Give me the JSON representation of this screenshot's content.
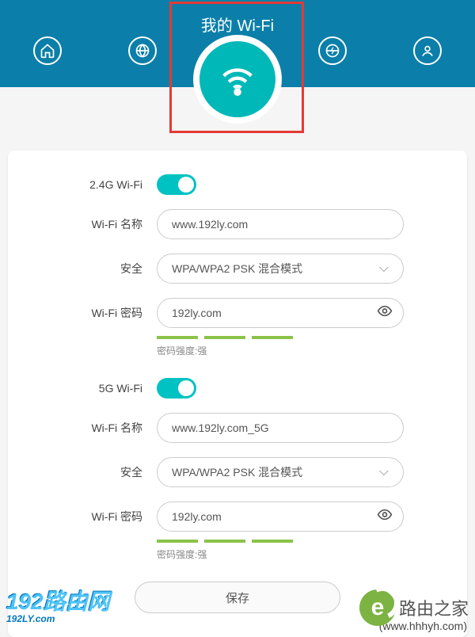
{
  "header": {
    "title": "我的 Wi-Fi",
    "nav": [
      "home",
      "globe",
      "wifi",
      "globe-bolt",
      "user"
    ]
  },
  "wifi24": {
    "band_label": "2.4G Wi-Fi",
    "enabled": true,
    "name_label": "Wi-Fi 名称",
    "name_value": "www.192ly.com",
    "security_label": "安全",
    "security_value": "WPA/WPA2 PSK 混合模式",
    "password_label": "Wi-Fi 密码",
    "password_value": "192ly.com",
    "strength_text": "密码强度:强"
  },
  "wifi5": {
    "band_label": "5G Wi-Fi",
    "enabled": true,
    "name_label": "Wi-Fi 名称",
    "name_value": "www.192ly.com_5G",
    "security_label": "安全",
    "security_value": "WPA/WPA2 PSK 混合模式",
    "password_label": "Wi-Fi 密码",
    "password_value": "192ly.com",
    "strength_text": "密码强度:强"
  },
  "save_label": "保存",
  "watermarks": {
    "left_main": "192路由网",
    "left_sub": "192LY.com",
    "right_text": "路由之家",
    "right_url": "(www.hhhyh.com)"
  }
}
